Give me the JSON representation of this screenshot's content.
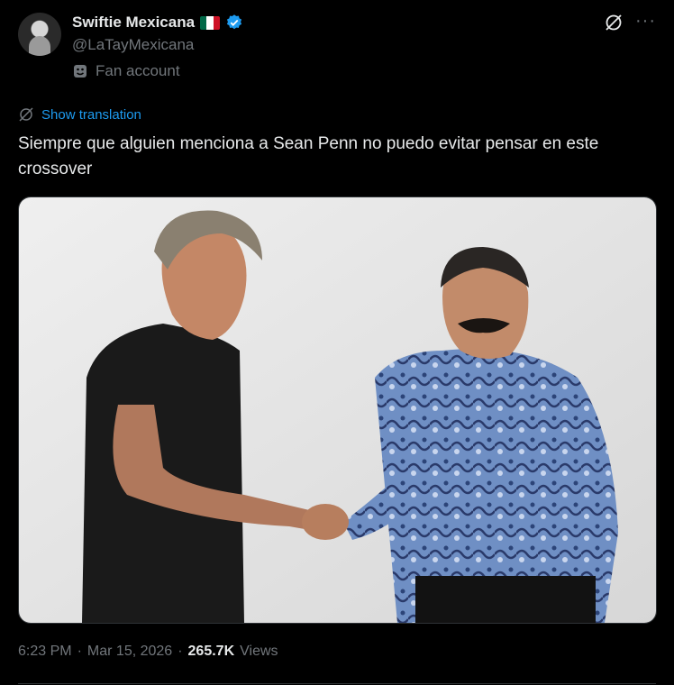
{
  "author": {
    "display_name": "Swiftie Mexicana",
    "handle": "@LaTayMexicana",
    "label": "Fan account",
    "flag": "mexico-flag",
    "verified_color": "#1d9bf0"
  },
  "actions": {
    "grok_icon": "grok-icon",
    "more_label": "···"
  },
  "translation": {
    "label": "Show translation",
    "color": "#1d9bf0"
  },
  "tweet": {
    "text": "Siempre que alguien menciona a Sean Penn no puedo evitar pensar en este crossover",
    "image": "photo-handshake"
  },
  "meta": {
    "time": "6:23 PM",
    "separator": "·",
    "date": "Mar 15, 2026",
    "views_count": "265.7K",
    "views_label": "Views"
  }
}
